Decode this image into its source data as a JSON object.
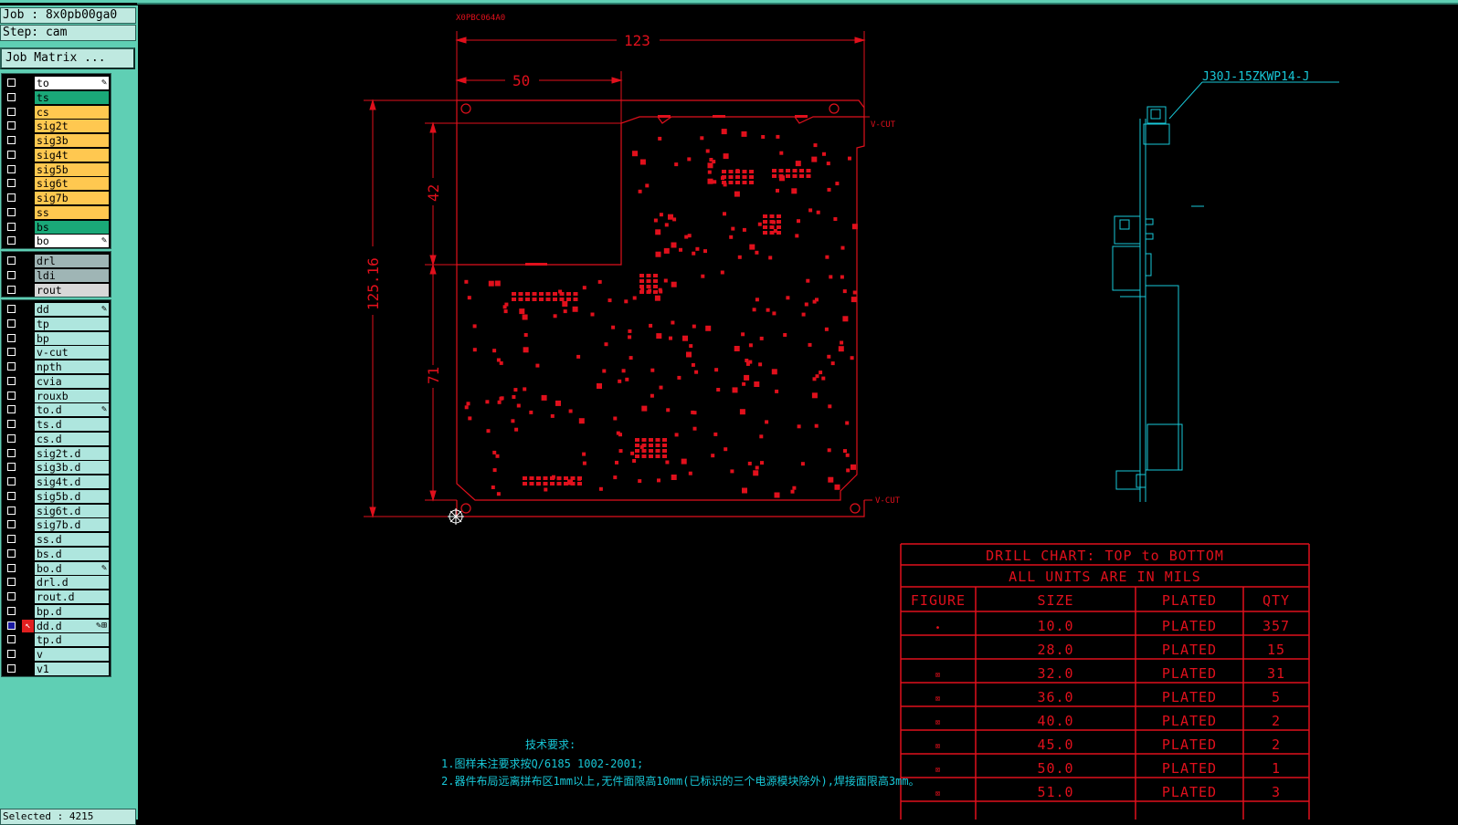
{
  "job_label": "Job : 8x0pb00ga0",
  "step_label": "Step: cam",
  "job_matrix_button": "Job Matrix ...",
  "selected_status": "Selected : 4215",
  "layer_groups": [
    {
      "layers": [
        {
          "name": "to",
          "color": "#ffffff",
          "mark": "✎"
        },
        {
          "name": "ts",
          "color": "#1aa878"
        },
        {
          "name": "cs",
          "color": "#ffc850"
        },
        {
          "name": "sig2t",
          "color": "#ffc850"
        },
        {
          "name": "sig3b",
          "color": "#ffc850"
        },
        {
          "name": "sig4t",
          "color": "#ffc850"
        },
        {
          "name": "sig5b",
          "color": "#ffc850"
        },
        {
          "name": "sig6t",
          "color": "#ffc850"
        },
        {
          "name": "sig7b",
          "color": "#ffc850"
        },
        {
          "name": "ss",
          "color": "#ffc850"
        },
        {
          "name": "bs",
          "color": "#1aa878"
        },
        {
          "name": "bo",
          "color": "#ffffff",
          "mark": "✎"
        }
      ]
    },
    {
      "layers": [
        {
          "name": "drl",
          "color": "#9fb5b5"
        },
        {
          "name": "ldi",
          "color": "#9fb5b5"
        },
        {
          "name": "rout",
          "color": "#d8d8d8"
        }
      ]
    },
    {
      "layers": [
        {
          "name": "dd",
          "color": "#aee6de",
          "mark": "✎"
        },
        {
          "name": "tp",
          "color": "#aee6de"
        },
        {
          "name": "bp",
          "color": "#aee6de"
        },
        {
          "name": "v-cut",
          "color": "#aee6de"
        },
        {
          "name": "npth",
          "color": "#aee6de"
        },
        {
          "name": "cvia",
          "color": "#aee6de"
        },
        {
          "name": "rouxb",
          "color": "#aee6de"
        },
        {
          "name": "to.d",
          "color": "#aee6de",
          "mark": "✎"
        },
        {
          "name": "ts.d",
          "color": "#aee6de"
        },
        {
          "name": "cs.d",
          "color": "#aee6de"
        },
        {
          "name": "sig2t.d",
          "color": "#aee6de"
        },
        {
          "name": "sig3b.d",
          "color": "#aee6de"
        },
        {
          "name": "sig4t.d",
          "color": "#aee6de"
        },
        {
          "name": "sig5b.d",
          "color": "#aee6de"
        },
        {
          "name": "sig6t.d",
          "color": "#aee6de"
        },
        {
          "name": "sig7b.d",
          "color": "#aee6de"
        },
        {
          "name": "ss.d",
          "color": "#aee6de"
        },
        {
          "name": "bs.d",
          "color": "#aee6de"
        },
        {
          "name": "bo.d",
          "color": "#aee6de",
          "mark": "✎"
        },
        {
          "name": "drl.d",
          "color": "#aee6de"
        },
        {
          "name": "rout.d",
          "color": "#aee6de"
        },
        {
          "name": "bp.d",
          "color": "#aee6de"
        },
        {
          "name": "dd.d",
          "color": "#aee6de",
          "mark": "✎⊞",
          "active": true
        },
        {
          "name": "tp.d",
          "color": "#aee6de"
        },
        {
          "name": "v",
          "color": "#aee6de"
        },
        {
          "name": "v1",
          "color": "#aee6de"
        }
      ]
    }
  ],
  "drawing": {
    "board_code": "X0PBC064A0",
    "dim_width": "123",
    "dim_cutout": "50",
    "dim_height": "125.16",
    "dim_upper": "42",
    "dim_lower": "71",
    "vcut_label": "V-CUT",
    "connector_label": "J30J-15ZKWP14-J",
    "tech_title": "技术要求:",
    "tech_line1": "1.图样未注要求按Q/6185 1002-2001;",
    "tech_line2": "2.器件布局远离拼布区1mm以上,无件面限高10mm(已标识的三个电源模块除外),焊接面限高3mm。",
    "colors": {
      "red": "#e0101c",
      "cyan": "#18c8d8",
      "bg": "#000000"
    }
  },
  "drill_chart": {
    "title": "DRILL CHART: TOP to BOTTOM",
    "subtitle": "ALL UNITS ARE IN MILS",
    "headers": [
      "FIGURE",
      "SIZE",
      "PLATED",
      "QTY"
    ],
    "rows": [
      {
        "figure": "•",
        "size": "10.0",
        "plated": "PLATED",
        "qty": "357"
      },
      {
        "figure": "",
        "size": "28.0",
        "plated": "PLATED",
        "qty": "15"
      },
      {
        "figure": "⌧",
        "size": "32.0",
        "plated": "PLATED",
        "qty": "31"
      },
      {
        "figure": "⌧",
        "size": "36.0",
        "plated": "PLATED",
        "qty": "5"
      },
      {
        "figure": "⌧",
        "size": "40.0",
        "plated": "PLATED",
        "qty": "2"
      },
      {
        "figure": "⌧",
        "size": "45.0",
        "plated": "PLATED",
        "qty": "2"
      },
      {
        "figure": "⌧",
        "size": "50.0",
        "plated": "PLATED",
        "qty": "1"
      },
      {
        "figure": "⌧",
        "size": "51.0",
        "plated": "PLATED",
        "qty": "3"
      }
    ]
  }
}
